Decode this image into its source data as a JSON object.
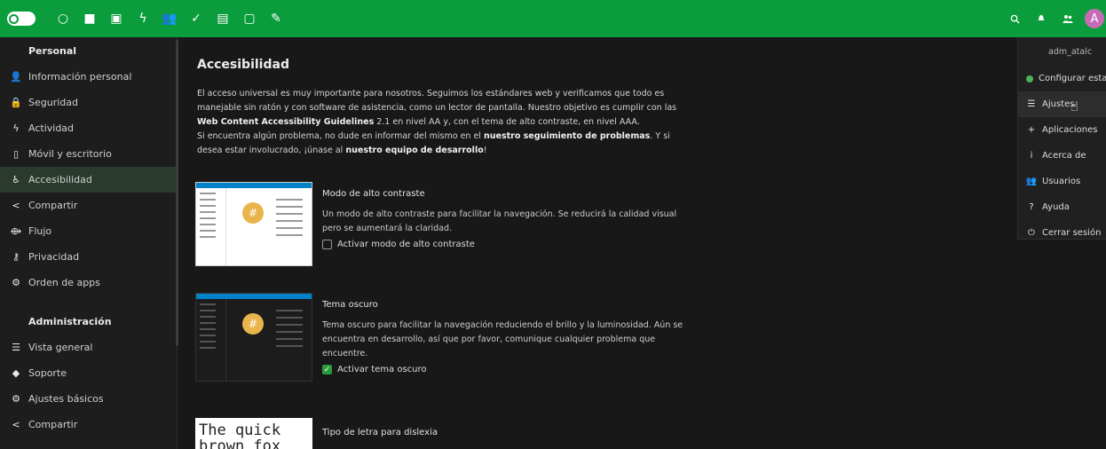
{
  "header": {
    "apps": [
      {
        "name": "dashboard-icon",
        "glyph": "○"
      },
      {
        "name": "files-icon",
        "glyph": "■"
      },
      {
        "name": "photos-icon",
        "glyph": "▣"
      },
      {
        "name": "activity-icon",
        "glyph": "ϟ"
      },
      {
        "name": "contacts-icon",
        "glyph": "👥"
      },
      {
        "name": "tasks-icon",
        "glyph": "✓"
      },
      {
        "name": "calendar-icon",
        "glyph": "▤"
      },
      {
        "name": "notes-icon",
        "glyph": "▢"
      },
      {
        "name": "edit-icon",
        "glyph": "✎"
      }
    ],
    "avatar_letter": "A",
    "accent": "#0b9c3c"
  },
  "sidebar": {
    "personal_heading": "Personal",
    "personal_items": [
      {
        "label": "Información personal",
        "icon": "user-icon",
        "glyph": "👤"
      },
      {
        "label": "Seguridad",
        "icon": "lock-icon",
        "glyph": "🔒"
      },
      {
        "label": "Actividad",
        "icon": "activity-icon",
        "glyph": "ϟ"
      },
      {
        "label": "Móvil y escritorio",
        "icon": "phone-icon",
        "glyph": "▯"
      },
      {
        "label": "Accesibilidad",
        "icon": "accessibility-icon",
        "glyph": "♿"
      },
      {
        "label": "Compartir",
        "icon": "share-icon",
        "glyph": "<"
      },
      {
        "label": "Flujo",
        "icon": "flow-icon",
        "glyph": "⟴"
      },
      {
        "label": "Privacidad",
        "icon": "key-icon",
        "glyph": "⚷"
      },
      {
        "label": "Orden de apps",
        "icon": "gear-icon",
        "glyph": "⚙"
      }
    ],
    "admin_heading": "Administración",
    "admin_items": [
      {
        "label": "Vista general",
        "icon": "list-icon",
        "glyph": "☰"
      },
      {
        "label": "Soporte",
        "icon": "support-icon",
        "glyph": "◆"
      },
      {
        "label": "Ajustes básicos",
        "icon": "gear-icon",
        "glyph": "⚙"
      },
      {
        "label": "Compartir",
        "icon": "share-icon",
        "glyph": "<"
      }
    ]
  },
  "main": {
    "title": "Accesibilidad",
    "intro": {
      "p1": "El acceso universal es muy importante para nosotros. Seguimos los estándares web y verificamos que todo es manejable sin ratón y con software de asistencia, como un lector de pantalla. Nuestro objetivo es cumplir con las ",
      "p1_bold": "Web Content Accessibility Guidelines",
      "p1_end": " 2.1 en nivel AA y, con el tema de alto contraste, en nivel AAA.",
      "p2": "Si encuentra algún problema, no dude en informar del mismo en el ",
      "p2_bold": "nuestro seguimiento de problemas",
      "p2_mid": ". Y si desea estar involucrado, ¡únase al ",
      "p2_bold2": "nuestro equipo de desarrollo",
      "p2_end": "!"
    },
    "high_contrast": {
      "title": "Modo de alto contraste",
      "description": "Un modo de alto contraste para facilitar la navegación. Se reducirá la calidad visual pero se aumentará la claridad.",
      "checkbox_label": "Activar modo de alto contraste",
      "checked": false
    },
    "dark_theme": {
      "title": "Tema oscuro",
      "description": "Tema oscuro para facilitar la navegación reduciendo el brillo y la luminosidad. Aún se encuentra en desarrollo, así que por favor, comunique cualquier problema que encuentre.",
      "checkbox_label": "Activar tema oscuro",
      "checked": true
    },
    "dyslexia": {
      "title": "Tipo de letra para dislexia",
      "preview_text": "The quick brown fox jumped"
    },
    "thumb_hash": "#"
  },
  "dropdown": {
    "username": "adm_atalc",
    "items": [
      {
        "label": "Configurar estado",
        "icon": "status-dot-icon"
      },
      {
        "label": "Ajustes",
        "icon": "settings-list-icon",
        "glyph": "☰"
      },
      {
        "label": "Aplicaciones",
        "icon": "plus-icon",
        "glyph": "+"
      },
      {
        "label": "Acerca de",
        "icon": "info-icon",
        "glyph": "i"
      },
      {
        "label": "Usuarios",
        "icon": "users-icon",
        "glyph": "👥"
      },
      {
        "label": "Ayuda",
        "icon": "help-icon",
        "glyph": "?"
      },
      {
        "label": "Cerrar sesión",
        "icon": "power-icon",
        "glyph": "⏻"
      }
    ]
  }
}
